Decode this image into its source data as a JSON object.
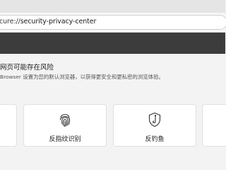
{
  "browser": {
    "address": {
      "prefix": "cure://",
      "host": "security-privacy-center"
    }
  },
  "main": {
    "warning_title": "网页可能存在风险",
    "warning_desc": "Browser 设置为您的默认浏览器，以获得更安全和更私密的浏览体验。",
    "cards": [
      {
        "icon": "fingerprint-icon",
        "label": "反指纹识别"
      },
      {
        "icon": "anti-phishing-hook-icon",
        "label": "反钓鱼"
      }
    ]
  }
}
